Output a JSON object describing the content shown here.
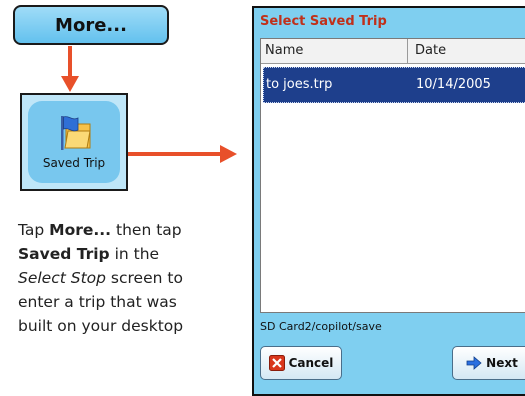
{
  "more_button": {
    "label": "More..."
  },
  "saved_trip_tile": {
    "label": "Saved Trip",
    "icon": "folder-flag-icon"
  },
  "caption": {
    "t1": "Tap ",
    "b1": "More...",
    "t2": " then tap ",
    "b2": "Saved Trip",
    "t3": " in the ",
    "i1": "Select Stop",
    "t4": " screen to enter a trip that was built on your desktop"
  },
  "dialog": {
    "title": "Select Saved Trip",
    "columns": {
      "name": "Name",
      "date": "Date"
    },
    "rows": [
      {
        "name": "to joes.trp",
        "date": "10/14/2005"
      }
    ],
    "path": "SD Card2/copilot/save",
    "cancel_label": "Cancel",
    "next_label": "Next"
  },
  "colors": {
    "arrow": "#e8502a",
    "title_red": "#c0301a",
    "selection_blue": "#1e3f8c",
    "panel_blue": "#7fcff0"
  }
}
